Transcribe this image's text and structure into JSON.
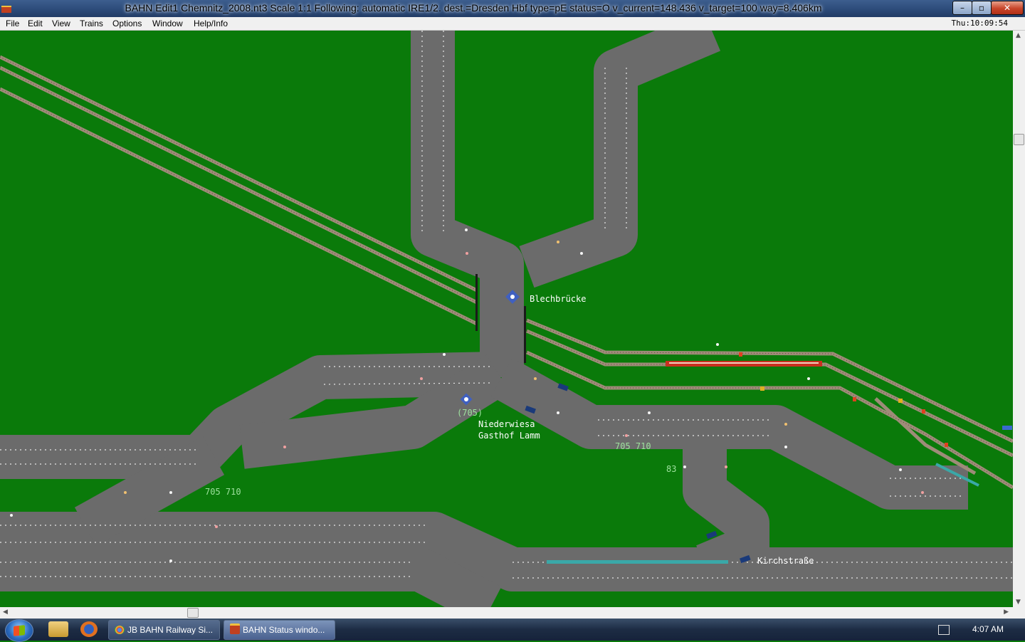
{
  "window": {
    "title": "BAHN Edit1 Chemnitz_2008.nt3 Scale 1:1 Following: automatic IRE1/2.  dest.=Dresden Hbf type=pE status=O  v_current=148.436 v_target=100 way=8.406km",
    "minimize": "–",
    "maximize": "▫",
    "close": "✕"
  },
  "menu": {
    "items": [
      "File",
      "Edit",
      "View",
      "Trains",
      "Options",
      "Window",
      "Help/Info"
    ],
    "clock": "Thu:10:09:54"
  },
  "map": {
    "labels": {
      "station_blechbruecke": "Blechbrücke",
      "station_niederwiesa_1": "Niederwiesa",
      "station_niederwiesa_2": "Gasthof Lamm",
      "station_kirchstrasse": "Kirchstraße",
      "line_705_paren": "(705)",
      "lines_705_710_a": "705 710",
      "lines_705_710_b": "705 710",
      "line_83": "83"
    },
    "colors": {
      "grass": "#0a7a0a",
      "road": "#6b6b6b",
      "rail": "#9e8c78",
      "label_white": "#ffffff",
      "label_green": "#9fe29f",
      "train": "#c83020"
    }
  },
  "taskbar": {
    "tasks": [
      {
        "label": "JB BAHN Railway Si...",
        "icon": "chrome-icon"
      },
      {
        "label": "BAHN Status windo...",
        "icon": "bahn-icon"
      }
    ],
    "clock": "4:07 AM"
  }
}
